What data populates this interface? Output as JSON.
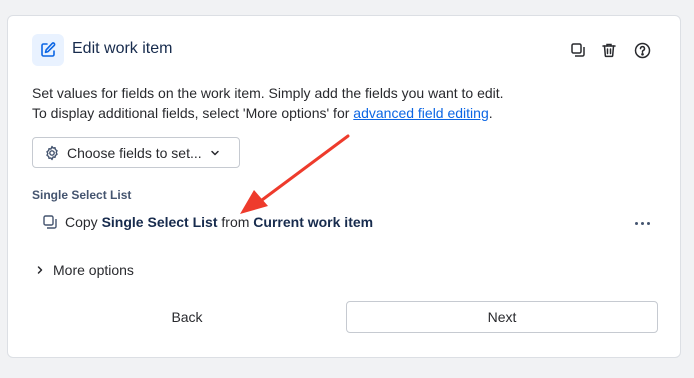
{
  "header": {
    "title": "Edit work item",
    "icons": [
      "edit-icon",
      "copy-icon",
      "trash-icon",
      "help-icon"
    ]
  },
  "description": {
    "line1": "Set values for fields on the work item. Simply add the fields you want to edit.",
    "line2_prefix": "To display additional fields, select 'More options' for ",
    "line2_link": "advanced field editing",
    "line2_suffix": "."
  },
  "choose_fields": {
    "label": "Choose fields to set...",
    "icons": [
      "gear-icon",
      "chevron-down-icon"
    ]
  },
  "field_section": {
    "label": "Single Select List",
    "action": {
      "verb": "Copy",
      "field": "Single Select List",
      "preposition": "from",
      "source": "Current work item"
    }
  },
  "more_options": {
    "label": "More options"
  },
  "footer": {
    "back_label": "Back",
    "next_label": "Next"
  },
  "colors": {
    "accent": "#0c66e4",
    "annotation_arrow": "#ee3b2c",
    "icon_bg": "#e9f2ff"
  }
}
